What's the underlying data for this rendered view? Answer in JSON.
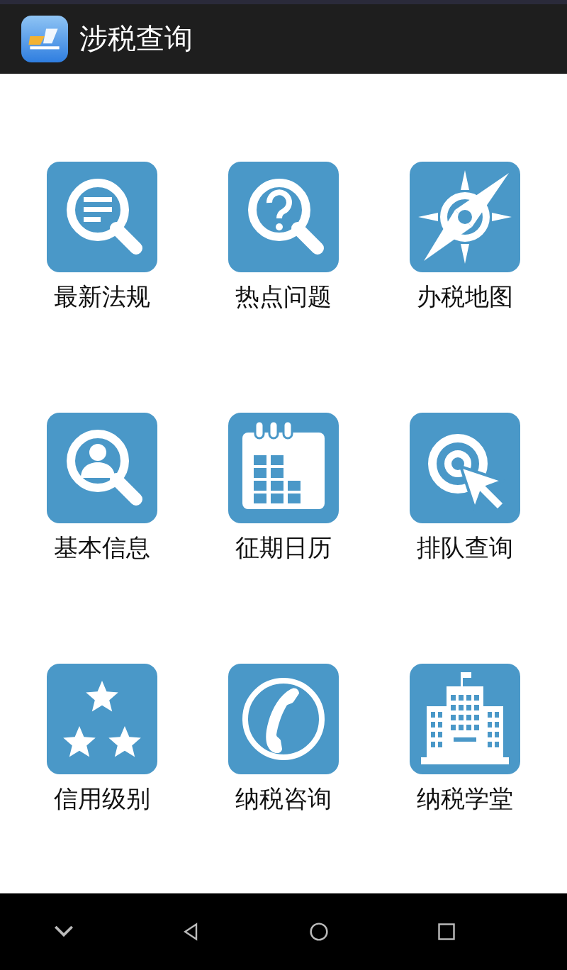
{
  "title_bar": {
    "title": "涉税查询"
  },
  "menu_items": [
    {
      "label": "最新法规",
      "kind": "document-search"
    },
    {
      "label": "热点问题",
      "kind": "question-search"
    },
    {
      "label": "办税地图",
      "kind": "compass"
    },
    {
      "label": "基本信息",
      "kind": "person-search"
    },
    {
      "label": "征期日历",
      "kind": "calendar"
    },
    {
      "label": "排队查询",
      "kind": "target-cursor"
    },
    {
      "label": "信用级别",
      "kind": "stars"
    },
    {
      "label": "纳税咨询",
      "kind": "phone"
    },
    {
      "label": "纳税学堂",
      "kind": "building"
    }
  ]
}
